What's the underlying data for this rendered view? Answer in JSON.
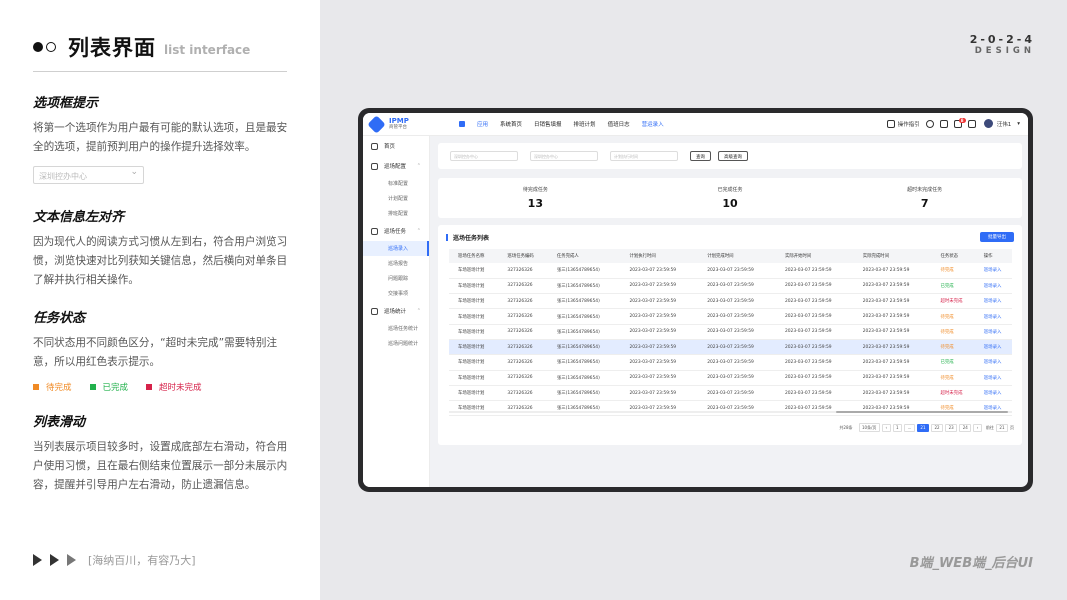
{
  "header": {
    "title": "列表界面",
    "subtitle": "list interface"
  },
  "brand": {
    "year": "2-0-2-4",
    "design": "DESIGN"
  },
  "sections": [
    {
      "title": "选项框提示",
      "body": "将第一个选项作为用户最有可能的默认选项，且是最安全的选项，提前预判用户的操作提升选择效率。"
    },
    {
      "title": "文本信息左对齐",
      "body": "因为现代人的阅读方式习惯从左到右，符合用户浏览习惯，浏览快速对比列获知关键信息，然后横向对单条目了解并执行相关操作。"
    },
    {
      "title": "任务状态",
      "body": "不同状态用不同颜色区分，“超时未完成”需要特别注意，所以用红色表示提示。"
    },
    {
      "title": "列表滑动",
      "body": "当列表展示项目较多时，设置成底部左右滑动，符合用户使用习惯，且在最右侧结束位置展示一部分未展示内容，提醒并引导用户左右滑动，防止遗漏信息。"
    }
  ],
  "example_select": "深圳控办中心",
  "legend": [
    {
      "label": "待完成",
      "color": "#f08a24"
    },
    {
      "label": "已完成",
      "color": "#22b14c"
    },
    {
      "label": "超时未完成",
      "color": "#d6224a"
    }
  ],
  "footer_left": "[海纳百川，有容乃大]",
  "footer_right": "B端_WEB端_后台UI",
  "colors": {
    "accent": "#2f6cf6"
  },
  "app": {
    "logo": "IPMP",
    "logo_sub": "商管平台",
    "nav": [
      "应用",
      "系统首页",
      "日销售填报",
      "排班计划",
      "值班日志",
      "营运录入"
    ],
    "nav_active": 5,
    "top_right": {
      "guide": "操作指引",
      "badge": "8",
      "user": "汪伟1"
    },
    "sidebar": [
      {
        "label": "首页",
        "type": "group",
        "icon": "home-icon"
      },
      {
        "label": "巡场配置",
        "type": "group",
        "icon": "config-icon"
      },
      {
        "label": "标准配置",
        "type": "item"
      },
      {
        "label": "计划配置",
        "type": "item"
      },
      {
        "label": "排班配置",
        "type": "item"
      },
      {
        "label": "巡场任务",
        "type": "group",
        "icon": "task-icon"
      },
      {
        "label": "巡场录入",
        "type": "item",
        "selected": true
      },
      {
        "label": "巡场报告",
        "type": "item"
      },
      {
        "label": "问题跟踪",
        "type": "item"
      },
      {
        "label": "交接事项",
        "type": "item"
      },
      {
        "label": "巡场统计",
        "type": "group",
        "icon": "stats-icon"
      },
      {
        "label": "巡场任务统计",
        "type": "item"
      },
      {
        "label": "巡场问题统计",
        "type": "item"
      }
    ],
    "filters": {
      "sel1": "深圳控办中心",
      "sel2": "深圳控办中心",
      "date": "计划执行时间",
      "query": "查询",
      "advanced": "高级查询"
    },
    "stats": [
      {
        "label": "待完成任务",
        "value": "13"
      },
      {
        "label": "已完成任务",
        "value": "10"
      },
      {
        "label": "超时未完成任务",
        "value": "7"
      }
    ],
    "table": {
      "title": "巡场任务列表",
      "export": "批量导出",
      "columns": [
        "巡场任务名称",
        "巡场任务编码",
        "任务完成人",
        "计划执行时间",
        "计划完成时间",
        "实际开始时间",
        "实际完成时间",
        "任务状态",
        "操作"
      ],
      "rows": [
        [
          "车场巡场计划",
          "327326326",
          "张三(13654789654)",
          "2023-03-07 23:59:59",
          "2023-03-07 23:59:59",
          "2023-03-07 23:59:59",
          "2023-03-07 23:59:59",
          "待完成",
          "巡场录入"
        ],
        [
          "车场巡场计划",
          "327326326",
          "张三(13654789654)",
          "2023-03-07 23:59:59",
          "2023-03-07 23:59:59",
          "2023-03-07 23:59:59",
          "2023-03-07 23:59:59",
          "已完成",
          "巡场录入"
        ],
        [
          "车场巡场计划",
          "327326326",
          "张三(13654789654)",
          "2023-03-07 23:59:59",
          "2023-03-07 23:59:59",
          "2023-03-07 23:59:59",
          "2023-03-07 23:59:59",
          "超时未完成",
          "巡场录入"
        ],
        [
          "车场巡场计划",
          "327326326",
          "张三(13654789654)",
          "2023-03-07 23:59:59",
          "2023-03-07 23:59:59",
          "2023-03-07 23:59:59",
          "2023-03-07 23:59:59",
          "待完成",
          "巡场录入"
        ],
        [
          "车场巡场计划",
          "327326326",
          "张三(13654789654)",
          "2023-03-07 23:59:59",
          "2023-03-07 23:59:59",
          "2023-03-07 23:59:59",
          "2023-03-07 23:59:59",
          "待完成",
          "巡场录入"
        ],
        [
          "车场巡场计划",
          "327326326",
          "张三(13654789654)",
          "2023-03-07 23:59:59",
          "2023-03-07 23:59:59",
          "2023-03-07 23:59:59",
          "2023-03-07 23:59:59",
          "待完成",
          "巡场录入"
        ],
        [
          "车场巡场计划",
          "327326326",
          "张三(13654789654)",
          "2023-03-07 23:59:59",
          "2023-03-07 23:59:59",
          "2023-03-07 23:59:59",
          "2023-03-07 23:59:59",
          "已完成",
          "巡场录入"
        ],
        [
          "车场巡场计划",
          "327326326",
          "张三(13654789654)",
          "2023-03-07 23:59:59",
          "2023-03-07 23:59:59",
          "2023-03-07 23:59:59",
          "2023-03-07 23:59:59",
          "待完成",
          "巡场录入"
        ],
        [
          "车场巡场计划",
          "327326326",
          "张三(13654789654)",
          "2023-03-07 23:59:59",
          "2023-03-07 23:59:59",
          "2023-03-07 23:59:59",
          "2023-03-07 23:59:59",
          "超时未完成",
          "巡场录入"
        ],
        [
          "车场巡场计划",
          "327326326",
          "张三(13654789654)",
          "2023-03-07 23:59:59",
          "2023-03-07 23:59:59",
          "2023-03-07 23:59:59",
          "2023-03-07 23:59:59",
          "待完成",
          "巡场录入"
        ]
      ],
      "highlight_row": 5
    },
    "pagination": {
      "total": "共28条",
      "per_page": "10条/页",
      "pages": [
        "1",
        "...",
        "21",
        "22",
        "23",
        "24"
      ],
      "active_page": "21",
      "goto": "前往",
      "goto_value": "21",
      "page_suffix": "页"
    }
  }
}
